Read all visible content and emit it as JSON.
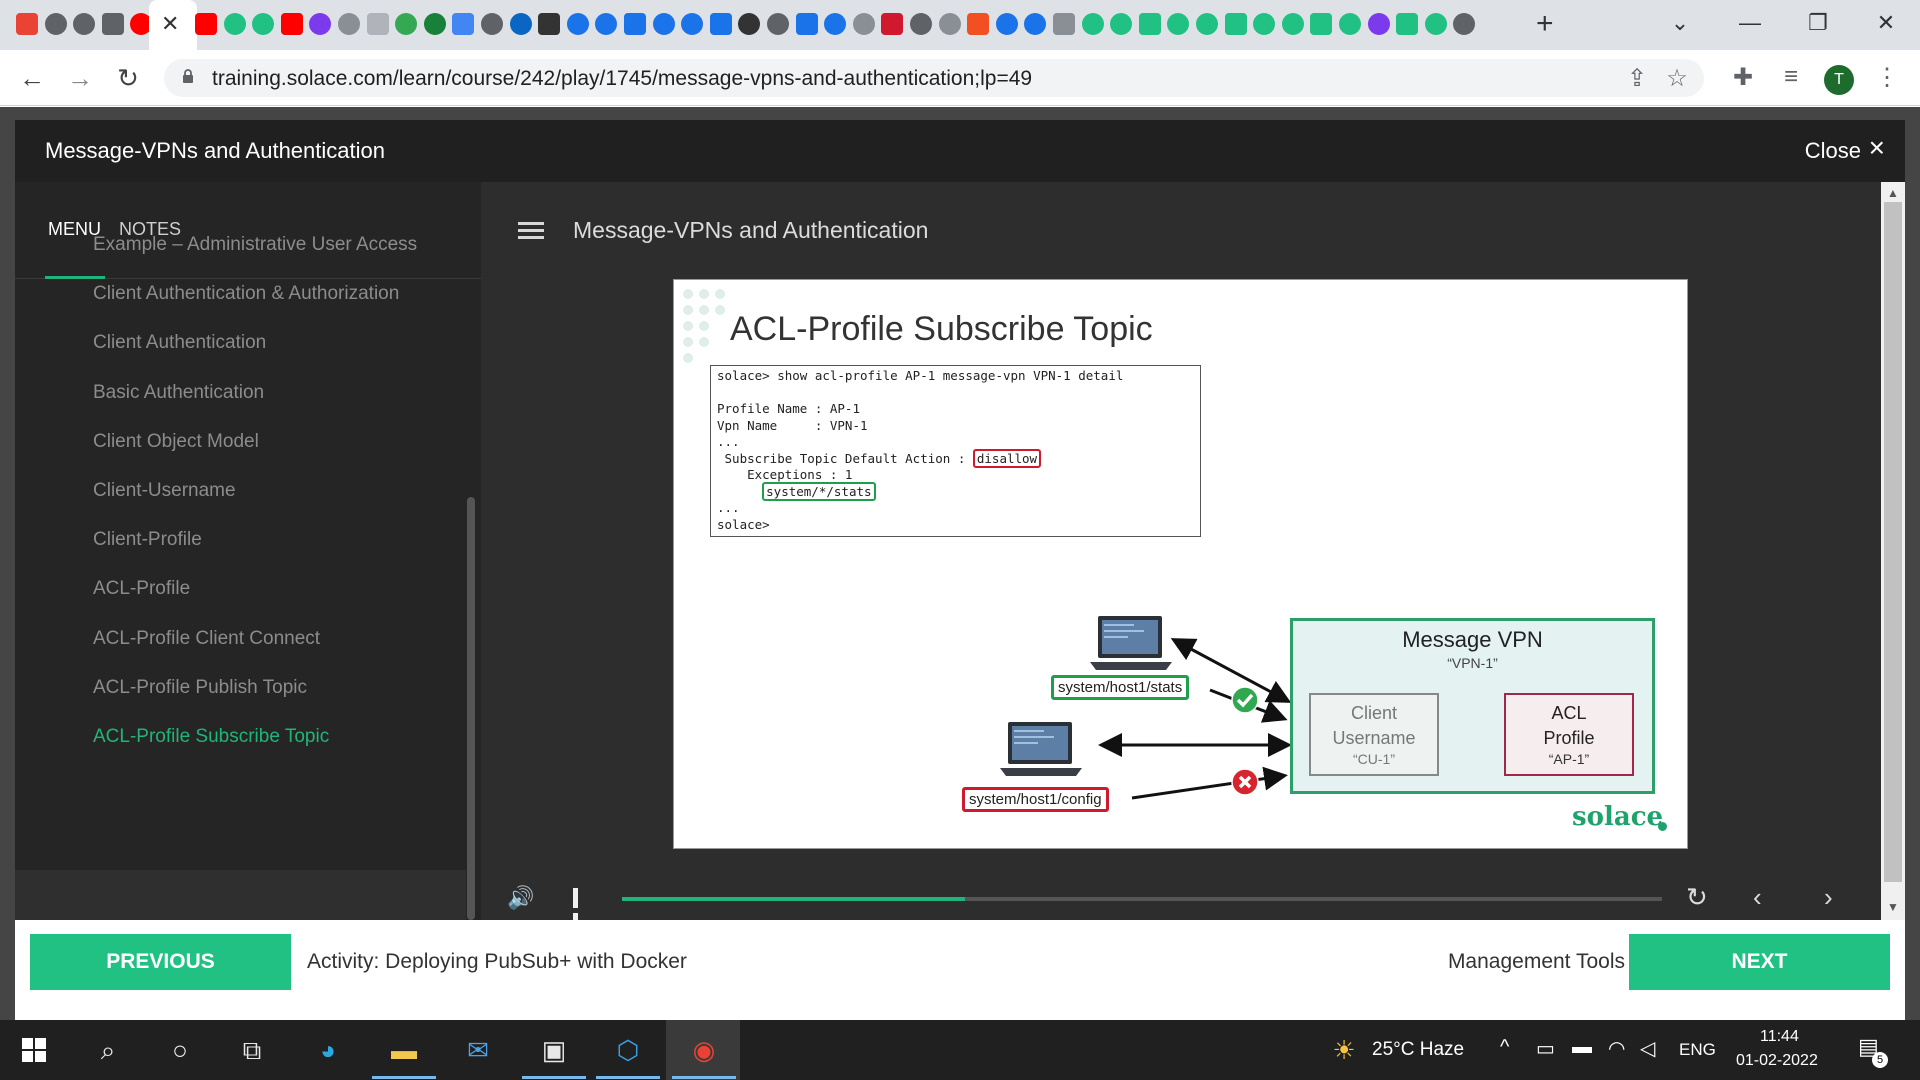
{
  "browser": {
    "url": "training.solace.com/learn/course/242/play/1745/message-vpns-and-authentication;lp=49",
    "profile_initial": "T",
    "tab_close": "✕",
    "new_tab": "+"
  },
  "player": {
    "header_title": "Message-VPNs and Authentication",
    "close_label": "Close",
    "close_icon": "×",
    "content_title": "Message-VPNs and Authentication"
  },
  "sidebar": {
    "tab_menu": "MENU",
    "tab_notes": "NOTES",
    "items": [
      "Example – Administrative User Access",
      "Client Authentication & Authorization",
      "Client Authentication",
      "Basic Authentication",
      "Client Object Model",
      "Client-Username",
      "Client-Profile",
      "ACL-Profile",
      "ACL-Profile Client Connect",
      "ACL-Profile Publish Topic",
      "ACL-Profile Subscribe Topic"
    ],
    "current_index": 10
  },
  "slide": {
    "title": "ACL-Profile Subscribe Topic",
    "code": {
      "line1": "solace> show acl-profile AP-1 message-vpn VPN-1 detail",
      "line2": "",
      "line3": "Profile Name : AP-1",
      "line4": "Vpn Name     : VPN-1",
      "line5": "...",
      "line6_prefix": " Subscribe Topic Default Action : ",
      "line6_value": "disallow",
      "line7": "    Exceptions : 1",
      "line8_indent": "      ",
      "line8_value": "system/*/stats",
      "line9": "...",
      "line10": "solace>"
    },
    "vpn": {
      "title": "Message VPN",
      "name": "“VPN-1”",
      "client_line1": "Client",
      "client_line2": "Username",
      "client_name": "“CU-1”",
      "acl_line1": "ACL",
      "acl_line2": "Profile",
      "acl_name": "“AP-1”"
    },
    "topic_allowed": "system/host1/stats",
    "topic_denied": "system/host1/config",
    "logo": "solace"
  },
  "media": {
    "progress": 0.33
  },
  "bottom_nav": {
    "previous_label": "PREVIOUS",
    "previous_title": "Activity: Deploying PubSub+ with Docker",
    "next_title": "Management Tools",
    "next_label": "NEXT"
  },
  "taskbar": {
    "weather": "25°C  Haze",
    "language": "ENG",
    "time": "11:44",
    "date": "01-02-2022",
    "notification_count": "5"
  },
  "colors": {
    "accent": "#1fb57a",
    "nav_button": "#20c183",
    "allow": "#1ea04a",
    "deny": "#d0192f"
  }
}
